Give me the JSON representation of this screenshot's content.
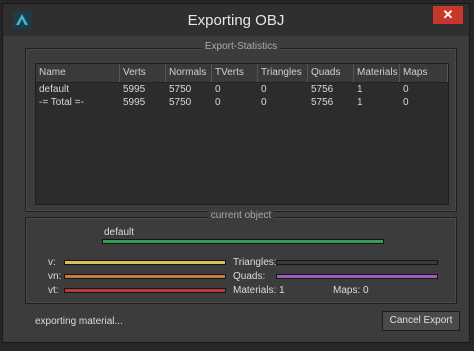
{
  "window": {
    "title": "Exporting OBJ",
    "close_label": "✕"
  },
  "stats": {
    "group_label": "Export-Statistics",
    "columns": [
      "Name",
      "Verts",
      "Normals",
      "TVerts",
      "Triangles",
      "Quads",
      "Materials",
      "Maps"
    ],
    "rows": [
      [
        "default",
        "5995",
        "5750",
        "0",
        "0",
        "5756",
        "1",
        "0"
      ],
      [
        "-= Total =-",
        "5995",
        "5750",
        "0",
        "0",
        "5756",
        "1",
        "0"
      ]
    ]
  },
  "current": {
    "group_label": "current object",
    "object_name": "default",
    "v_label": "v:",
    "vn_label": "vn:",
    "vt_label": "vt:",
    "triangles_label": "Triangles:",
    "quads_label": "Quads:",
    "materials_label": "Materials:  1",
    "maps_label": "Maps:  0",
    "object_progress": 1.0,
    "v_progress": 1.0,
    "vn_progress": 1.0,
    "vt_progress": 1.0,
    "triangles_progress": 0.0,
    "quads_progress": 1.0
  },
  "footer": {
    "status": "exporting material...",
    "cancel_label": "Cancel Export"
  },
  "colors": {
    "object": "#3a9a5a",
    "v": "#d6c05a",
    "vn": "#c87a3a",
    "vt": "#b83a3a",
    "quads": "#9a5ac0",
    "triangles": "#555555"
  }
}
